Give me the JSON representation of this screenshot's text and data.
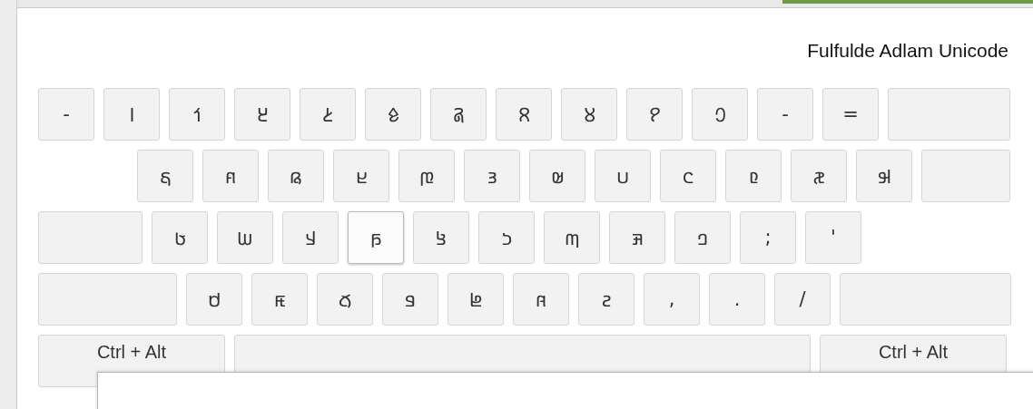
{
  "keyboard": {
    "title": "Fulfulde Adlam Unicode",
    "rows": [
      [
        {
          "kind": "char",
          "label": "-",
          "hovered": false
        },
        {
          "kind": "char",
          "label": "𞥑",
          "hovered": false
        },
        {
          "kind": "char",
          "label": "𞥒",
          "hovered": false
        },
        {
          "kind": "char",
          "label": "𞥓",
          "hovered": false
        },
        {
          "kind": "char",
          "label": "𞥔",
          "hovered": false
        },
        {
          "kind": "char",
          "label": "𞥕",
          "hovered": false
        },
        {
          "kind": "char",
          "label": "𞥖",
          "hovered": false
        },
        {
          "kind": "char",
          "label": "𞥗",
          "hovered": false
        },
        {
          "kind": "char",
          "label": "𞥘",
          "hovered": false
        },
        {
          "kind": "char",
          "label": "𞥙",
          "hovered": false
        },
        {
          "kind": "char",
          "label": "𞥐",
          "hovered": false
        },
        {
          "kind": "char",
          "label": "-",
          "hovered": false
        },
        {
          "kind": "char",
          "label": "=",
          "hovered": false
        },
        {
          "kind": "backspace",
          "hovered": false
        }
      ],
      [
        {
          "kind": "char",
          "label": "𞤻",
          "hovered": false
        },
        {
          "kind": "char",
          "label": "𞤱",
          "hovered": false
        },
        {
          "kind": "char",
          "label": "𞤫",
          "hovered": false
        },
        {
          "kind": "char",
          "label": "𞤪",
          "hovered": false
        },
        {
          "kind": "char",
          "label": "𞤼",
          "hovered": false
        },
        {
          "kind": "char",
          "label": "𞤴",
          "hovered": false
        },
        {
          "kind": "char",
          "label": "𞤵",
          "hovered": false
        },
        {
          "kind": "char",
          "label": "𞤭",
          "hovered": false
        },
        {
          "kind": "char",
          "label": "𞤮",
          "hovered": false
        },
        {
          "kind": "char",
          "label": "𞤨",
          "hovered": false
        },
        {
          "kind": "char",
          "label": "𞤽",
          "hovered": false
        },
        {
          "kind": "char",
          "label": "𞤹",
          "hovered": false
        },
        {
          "kind": "enter",
          "hovered": false
        }
      ],
      [
        {
          "kind": "caps",
          "hovered": false
        },
        {
          "kind": "char",
          "label": "𞤢",
          "hovered": false
        },
        {
          "kind": "char",
          "label": "𞤧",
          "hovered": false
        },
        {
          "kind": "char",
          "label": "𞤣",
          "hovered": false
        },
        {
          "kind": "char",
          "label": "𞤬",
          "hovered": true
        },
        {
          "kind": "char",
          "label": "𞤺",
          "hovered": false
        },
        {
          "kind": "char",
          "label": "𞤸",
          "hovered": false
        },
        {
          "kind": "char",
          "label": "𞤶",
          "hovered": false
        },
        {
          "kind": "char",
          "label": "𞤳",
          "hovered": false
        },
        {
          "kind": "char",
          "label": "𞤤",
          "hovered": false
        },
        {
          "kind": "char",
          "label": ";",
          "hovered": false
        },
        {
          "kind": "char",
          "label": "'",
          "hovered": false
        }
      ],
      [
        {
          "kind": "shift",
          "hovered": false
        },
        {
          "kind": "char",
          "label": "𞤯",
          "hovered": false
        },
        {
          "kind": "char",
          "label": "𞤿",
          "hovered": false
        },
        {
          "kind": "char",
          "label": "𞤷",
          "hovered": false
        },
        {
          "kind": "char",
          "label": "𞤥",
          "hovered": false
        },
        {
          "kind": "char",
          "label": "𞤦",
          "hovered": false
        },
        {
          "kind": "char",
          "label": "𞤾",
          "hovered": false
        },
        {
          "kind": "char",
          "label": "𞤲",
          "hovered": false
        },
        {
          "kind": "char",
          "label": ",",
          "hovered": false
        },
        {
          "kind": "char",
          "label": ".",
          "hovered": false
        },
        {
          "kind": "char",
          "label": "/",
          "hovered": false
        },
        {
          "kind": "shift_right",
          "hovered": false
        }
      ],
      [
        {
          "kind": "modifier",
          "label": "Ctrl + Alt",
          "hovered": false
        },
        {
          "kind": "space",
          "hovered": false
        },
        {
          "kind": "modifier",
          "label": "Ctrl + Alt",
          "hovered": false
        }
      ]
    ]
  }
}
